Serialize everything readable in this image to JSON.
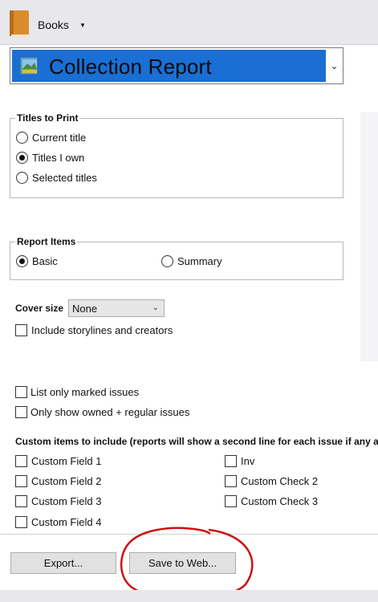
{
  "app": {
    "name": "Books"
  },
  "report": {
    "title": "Collection Report"
  },
  "titles_to_print": {
    "heading": "Titles to Print",
    "options": [
      "Current title",
      "Titles I own",
      "Selected titles"
    ],
    "selected": "Titles I own"
  },
  "report_items": {
    "heading": "Report Items",
    "options": [
      "Basic",
      "Summary"
    ],
    "selected": "Basic"
  },
  "cover_size": {
    "label": "Cover size",
    "value": "None"
  },
  "checks": {
    "include_storylines": "Include storylines and creators",
    "list_marked": "List only marked issues",
    "only_owned": "Only show owned + regular issues"
  },
  "custom_items": {
    "heading": "Custom items to include (reports will show a second line for each issue if any are",
    "left": [
      "Custom Field 1",
      "Custom Field 2",
      "Custom Field 3",
      "Custom Field 4"
    ],
    "right": [
      "Inv",
      "Custom Check 2",
      "Custom Check 3"
    ]
  },
  "buttons": {
    "export": "Export...",
    "save_to_web": "Save to Web..."
  },
  "colors": {
    "accent": "#1a6fd4",
    "annotation": "#cc1111"
  }
}
